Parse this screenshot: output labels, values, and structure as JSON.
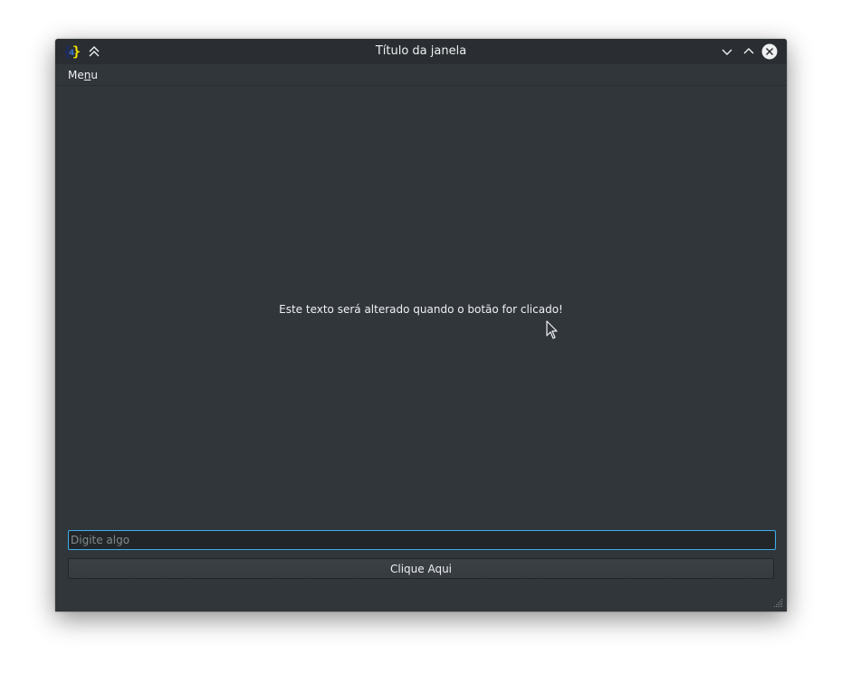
{
  "window": {
    "title": "Título da janela",
    "app_icon": "braces-app-icon"
  },
  "titlebar_buttons": {
    "keep_above_icon": "double-chevron-up-icon",
    "minimize_icon": "chevron-down-icon",
    "maximize_icon": "chevron-up-icon",
    "close_icon": "close-circle-icon"
  },
  "menubar": {
    "menu_prefix": "Me",
    "menu_mnemonic": "n",
    "menu_suffix": "u"
  },
  "content": {
    "label_text": "Este texto será alterado quando o botão for clicado!"
  },
  "input": {
    "value": "",
    "placeholder": "Digite algo"
  },
  "button": {
    "label": "Clique Aqui"
  },
  "colors": {
    "window_bg": "#31363b",
    "titlebar_bg": "#2a2e32",
    "text": "#eff0f1",
    "focus_accent": "#3daee9"
  }
}
